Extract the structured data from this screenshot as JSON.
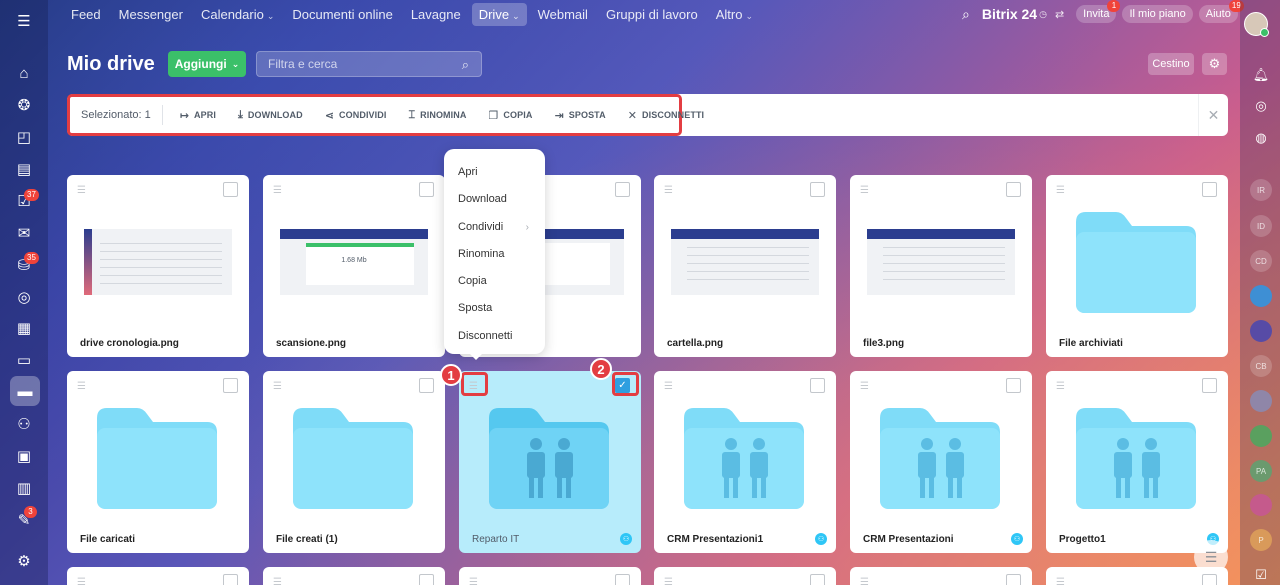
{
  "nav": {
    "items": [
      {
        "label": "Feed",
        "dropdown": false,
        "active": false
      },
      {
        "label": "Messenger",
        "dropdown": false,
        "active": false
      },
      {
        "label": "Calendario",
        "dropdown": true,
        "active": false
      },
      {
        "label": "Documenti online",
        "dropdown": false,
        "active": false
      },
      {
        "label": "Lavagne",
        "dropdown": false,
        "active": false
      },
      {
        "label": "Drive",
        "dropdown": true,
        "active": true
      },
      {
        "label": "Webmail",
        "dropdown": false,
        "active": false
      },
      {
        "label": "Gruppi di lavoro",
        "dropdown": false,
        "active": false
      },
      {
        "label": "Altro",
        "dropdown": true,
        "active": false
      }
    ],
    "brand": "Bitrix 24",
    "invite_label": "Invita",
    "invite_badge": "1",
    "plan_label": "Il mio piano",
    "help_label": "Aiuto",
    "help_badge": "19"
  },
  "left_sidebar": {
    "badges": {
      "tasks": "37",
      "feed": "35",
      "notes": "3"
    }
  },
  "right_sidebar": {
    "avatars": [
      "IR",
      "ID",
      "CD",
      "CB",
      "PA",
      "P"
    ]
  },
  "page": {
    "title": "Mio drive",
    "add_label": "Aggiungi",
    "search_placeholder": "Filtra e cerca",
    "trash_label": "Cestino"
  },
  "action_bar": {
    "selected_label": "Selezionato: 1",
    "actions": [
      {
        "label": "APRI",
        "icon": "open-icon"
      },
      {
        "label": "DOWNLOAD",
        "icon": "download-icon"
      },
      {
        "label": "CONDIVIDI",
        "icon": "share-icon"
      },
      {
        "label": "RINOMINA",
        "icon": "rename-icon"
      },
      {
        "label": "COPIA",
        "icon": "copy-icon"
      },
      {
        "label": "SPOSTA",
        "icon": "move-icon"
      },
      {
        "label": "DISCONNETTI",
        "icon": "disconnect-icon"
      }
    ]
  },
  "context_menu": {
    "items": [
      "Apri",
      "Download",
      "Condividi",
      "Rinomina",
      "Copia",
      "Sposta",
      "Disconnetti"
    ]
  },
  "annotations": [
    "1",
    "2"
  ],
  "cards_row1": [
    {
      "name": "drive cronologia.png",
      "type": "image"
    },
    {
      "name": "scansione.png",
      "type": "image",
      "thumb_text": "1.68 Mb"
    },
    {
      "name": "",
      "type": "image"
    },
    {
      "name": "cartella.png",
      "type": "image"
    },
    {
      "name": "file3.png",
      "type": "image"
    },
    {
      "name": "File archiviati",
      "type": "folder"
    }
  ],
  "cards_row2": [
    {
      "name": "File caricati",
      "type": "folder",
      "shared": false
    },
    {
      "name": "File creati (1)",
      "type": "folder",
      "shared": false
    },
    {
      "name": "Reparto IT",
      "type": "shared-folder",
      "shared": true,
      "selected": true
    },
    {
      "name": "CRM Presentazioni1",
      "type": "shared-folder",
      "shared": true
    },
    {
      "name": "CRM Presentazioni",
      "type": "shared-folder",
      "shared": true
    },
    {
      "name": "Progetto1",
      "type": "shared-folder",
      "shared": true
    }
  ],
  "colors": {
    "accent_green": "#3bc069",
    "highlight_red": "#e33d42",
    "folder_blue": "#7fdcf8",
    "selected_bg": "#b7ecfb"
  }
}
